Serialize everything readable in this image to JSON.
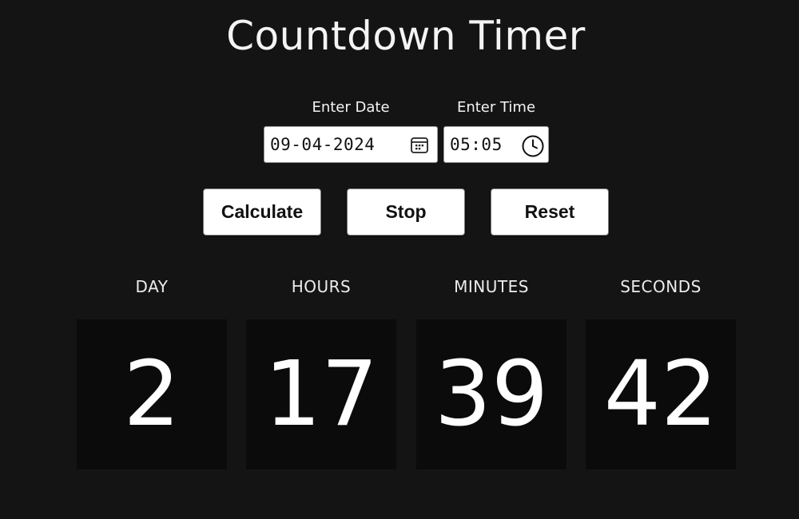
{
  "app": {
    "title": "Countdown Timer"
  },
  "form": {
    "date": {
      "label": "Enter Date",
      "value": "09-04-2024",
      "icon": "calendar-icon"
    },
    "time": {
      "label": "Enter Time",
      "value": "05:05",
      "icon": "clock-icon"
    }
  },
  "buttons": {
    "calculate": "Calculate",
    "stop": "Stop",
    "reset": "Reset"
  },
  "countdown": [
    {
      "unit": "DAY",
      "value": "2"
    },
    {
      "unit": "HOURS",
      "value": "17"
    },
    {
      "unit": "MINUTES",
      "value": "39"
    },
    {
      "unit": "SECONDS",
      "value": "42"
    }
  ],
  "colors": {
    "background": "#141414",
    "tile": "#0b0b0b",
    "text": "#ffffff",
    "button": "#ffffff"
  }
}
